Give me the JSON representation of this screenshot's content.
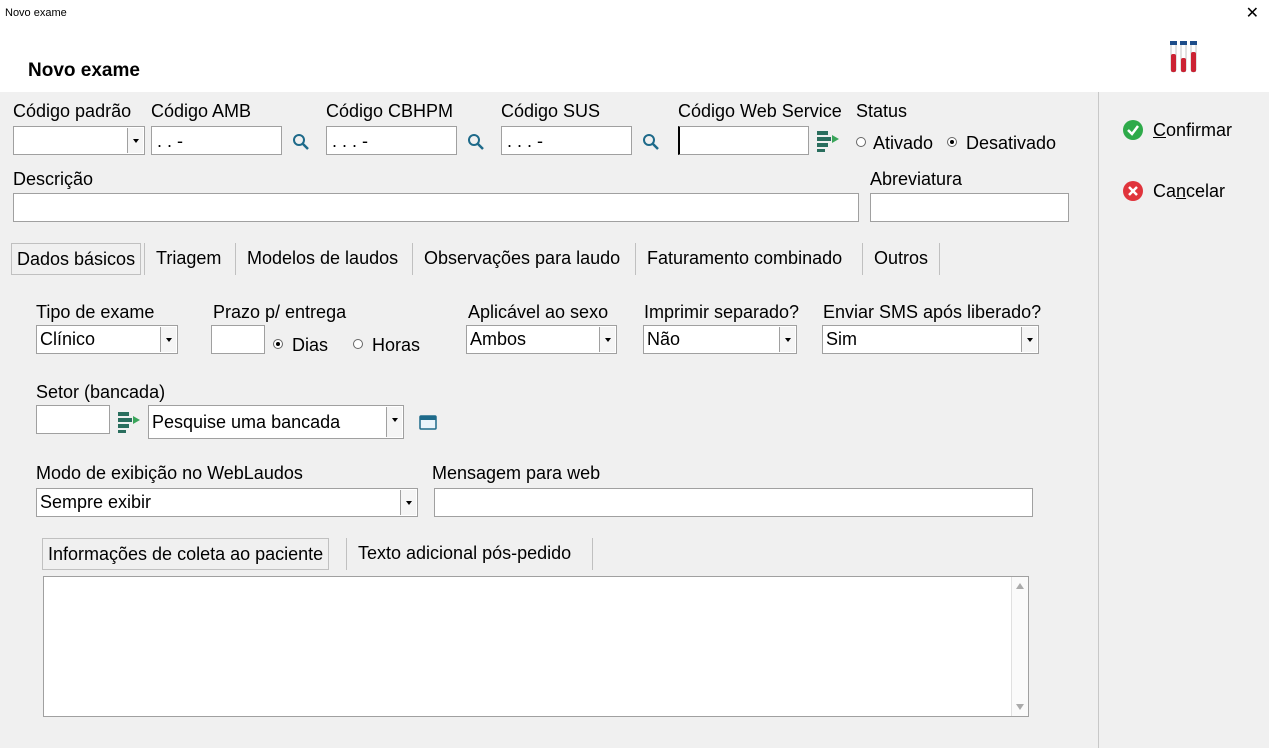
{
  "window": {
    "title": "Novo exame",
    "close_glyph": "✕"
  },
  "header": {
    "title": "Novo exame"
  },
  "fields": {
    "codigo_padrao": {
      "label": "Código padrão",
      "value": ""
    },
    "codigo_amb": {
      "label": "Código AMB",
      "value": " .  .  -"
    },
    "codigo_cbhpm": {
      "label": "Código CBHPM",
      "value": " .  .  .  -"
    },
    "codigo_sus": {
      "label": "Código SUS",
      "value": " .  .  .  -"
    },
    "codigo_ws": {
      "label": "Código Web Service",
      "value": ""
    },
    "status": {
      "label": "Status",
      "options": [
        "Ativado",
        "Desativado"
      ],
      "selected": "Desativado"
    },
    "descricao": {
      "label": "Descrição",
      "value": ""
    },
    "abreviatura": {
      "label": "Abreviatura",
      "value": ""
    }
  },
  "tabs": [
    {
      "label": "Dados básicos",
      "active": true
    },
    {
      "label": "Triagem",
      "active": false
    },
    {
      "label": "Modelos de laudos",
      "active": false
    },
    {
      "label": "Observações para laudo",
      "active": false
    },
    {
      "label": "Faturamento combinado",
      "active": false
    },
    {
      "label": "Outros",
      "active": false
    }
  ],
  "dados": {
    "tipo_exame": {
      "label": "Tipo de exame",
      "value": "Clínico"
    },
    "prazo": {
      "label": "Prazo p/ entrega",
      "value": "",
      "options": [
        "Dias",
        "Horas"
      ],
      "selected": "Dias"
    },
    "sexo": {
      "label": "Aplicável ao sexo",
      "value": "Ambos"
    },
    "imprimir": {
      "label": "Imprimir separado?",
      "value": "Não"
    },
    "sms": {
      "label": "Enviar SMS após liberado?",
      "value": "Sim"
    },
    "setor": {
      "label": "Setor (bancada)",
      "code": "",
      "placeholder": "Pesquise uma bancada"
    },
    "modo": {
      "label": "Modo de exibição no WebLaudos",
      "value": "Sempre exibir"
    },
    "mensagem": {
      "label": "Mensagem para web",
      "value": ""
    }
  },
  "subtabs": [
    {
      "label": "Informações de coleta ao paciente",
      "active": true
    },
    {
      "label": "Texto adicional pós-pedido",
      "active": false
    }
  ],
  "side": {
    "confirm": {
      "pre": "",
      "mnemonic": "C",
      "rest": "onfirmar"
    },
    "cancel": {
      "pre": "Ca",
      "mnemonic": "n",
      "rest": "celar"
    }
  },
  "colors": {
    "confirm": "#2eaa4a",
    "cancel": "#e0343c",
    "tool": "#2a6e5e",
    "search": "#1e6a8a"
  }
}
